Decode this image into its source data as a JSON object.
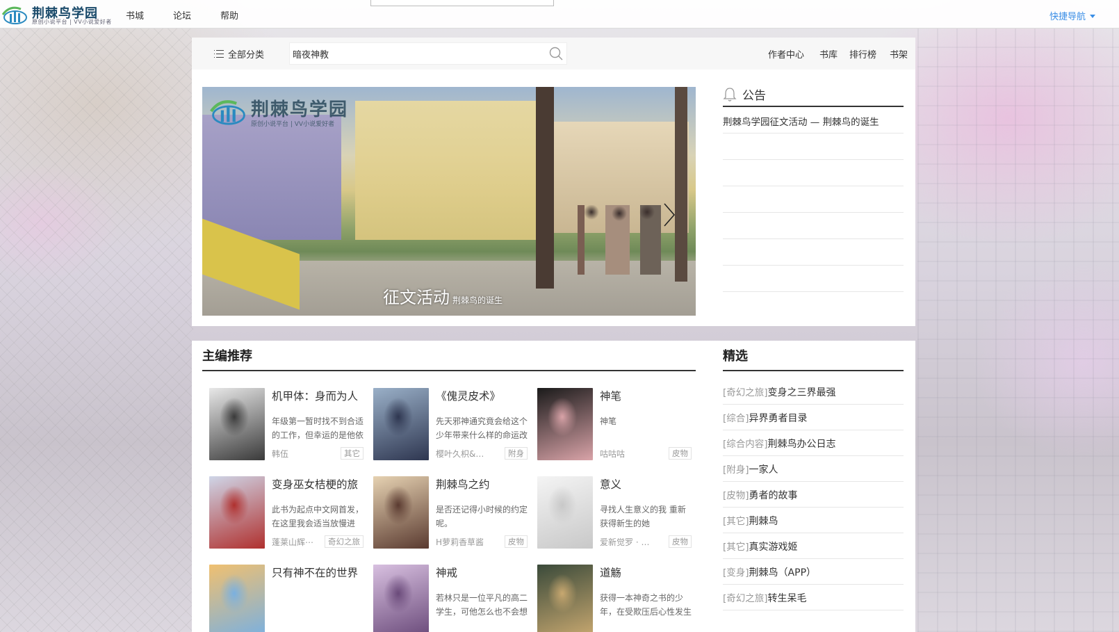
{
  "header": {
    "logo_title": "荆棘鸟学园",
    "logo_sub": "原创小说平台 | VV小说爱好者",
    "nav": [
      "书城",
      "论坛",
      "帮助"
    ],
    "quick_nav": "快捷导航"
  },
  "search": {
    "category_label": "全部分类",
    "value": "暗夜神教",
    "links": [
      "作者中心",
      "书库",
      "排行榜",
      "书架"
    ]
  },
  "banner": {
    "logo_title": "荆棘鸟学园",
    "logo_sub": "原创小说平台 | VV小说爱好者",
    "caption_big": "征文活动",
    "caption_small": "荆棘鸟的诞生"
  },
  "notice": {
    "title": "公告",
    "items": [
      "荆棘鸟学园征文活动 — 荆棘鸟的诞生",
      "",
      "",
      "",
      "",
      "",
      ""
    ]
  },
  "recommend": {
    "title": "主编推荐",
    "items": [
      {
        "title": "机甲体：身而为人",
        "desc": "年级第一暂时找不到合适的工作，但幸运的是他依",
        "author": "韩伍",
        "tag": "其它",
        "c1": "#e8e8e8",
        "c2": "#3a3a3a"
      },
      {
        "title": "《傀灵皮术》",
        "desc": "先天邪神通究竟会给这个少年带来什么样的命运改",
        "author": "樱叶久枳&禁平酱",
        "tag": "附身",
        "c1": "#9ab0c8",
        "c2": "#2e3650"
      },
      {
        "title": "神笔",
        "desc": "神笔",
        "author": "咕咕咕",
        "tag": "皮物",
        "c1": "#1a1a1a",
        "c2": "#d9a3a8"
      },
      {
        "title": "变身巫女桔梗的旅",
        "desc": "此书为起点中文网首发，在这里我会适当放慢进",
        "author": "蓬莱山辉⋯",
        "tag": "奇幻之旅",
        "c1": "#cfd6e8",
        "c2": "#b0302e"
      },
      {
        "title": "荆棘鸟之约",
        "desc": "是否还记得小时候的约定呢。",
        "author": "H萝莉香草酱",
        "tag": "皮物",
        "c1": "#e6d2b2",
        "c2": "#5a3a30"
      },
      {
        "title": "意义",
        "desc": "寻找人生意义的我 重新获得新生的她",
        "author": "爱新觉罗 · 溥洁",
        "tag": "皮物",
        "c1": "#f4f4f4",
        "c2": "#c8c8c8"
      },
      {
        "title": "只有神不在的世界",
        "desc": "",
        "author": "",
        "tag": "",
        "c1": "#f0c070",
        "c2": "#7ab0e0"
      },
      {
        "title": "神戒",
        "desc": "若林只是一位平凡的高二学生，可他怎么也不会想",
        "author": "",
        "tag": "",
        "c1": "#d8c0e0",
        "c2": "#6a4a7a"
      },
      {
        "title": "道觞",
        "desc": "获得一本神奇之书的少年，在受欺压后心性发生",
        "author": "",
        "tag": "",
        "c1": "#3a4a3a",
        "c2": "#c8a870"
      }
    ]
  },
  "picks": {
    "title": "精选",
    "items": [
      {
        "genre": "[奇幻之旅]",
        "name": "变身之三界最强"
      },
      {
        "genre": "[综合]",
        "name": "异界勇者目录"
      },
      {
        "genre": "[综合内容]",
        "name": "荆棘鸟办公日志"
      },
      {
        "genre": "[附身]",
        "name": "一家人"
      },
      {
        "genre": "[皮物]",
        "name": "勇者的故事"
      },
      {
        "genre": "[其它]",
        "name": "荆棘鸟"
      },
      {
        "genre": "[其它]",
        "name": "真实游戏姬"
      },
      {
        "genre": "[变身]",
        "name": "荆棘鸟（APP）"
      },
      {
        "genre": "[奇幻之旅]",
        "name": "转生呆毛"
      }
    ]
  },
  "colors": {
    "accent": "#3a8ee6",
    "text": "#333333",
    "muted": "#999999"
  },
  "icons": [
    "site-logo-icon",
    "category-list-icon",
    "search-icon",
    "bell-icon",
    "chevron-right-icon",
    "caret-down-icon"
  ]
}
